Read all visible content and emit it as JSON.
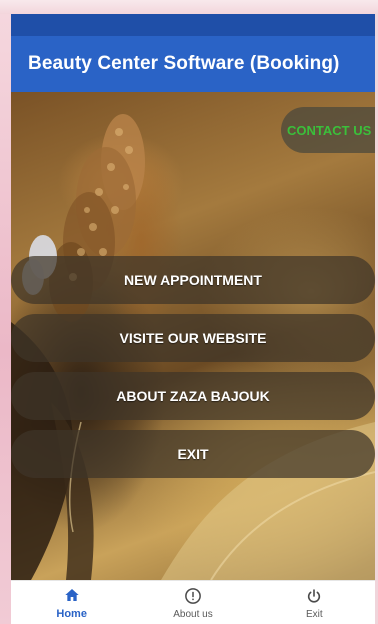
{
  "app": {
    "title": "Beauty Center Software (Booking)"
  },
  "contact_button": {
    "label": "CONTACT US",
    "color": "#3bbf3b"
  },
  "menu": [
    {
      "label": "NEW APPOINTMENT"
    },
    {
      "label": "VISITE OUR WEBSITE"
    },
    {
      "label": "ABOUT ZAZA BAJOUK"
    },
    {
      "label": "EXIT"
    }
  ],
  "bottom_nav": [
    {
      "label": "Home",
      "icon": "home-icon",
      "active": true
    },
    {
      "label": "About us",
      "icon": "info-icon",
      "active": false
    },
    {
      "label": "Exit",
      "icon": "power-icon",
      "active": false
    }
  ],
  "colors": {
    "app_bar": "#2a63c6",
    "status_bar": "#1f4fa8",
    "accent": "#2a63c6"
  }
}
